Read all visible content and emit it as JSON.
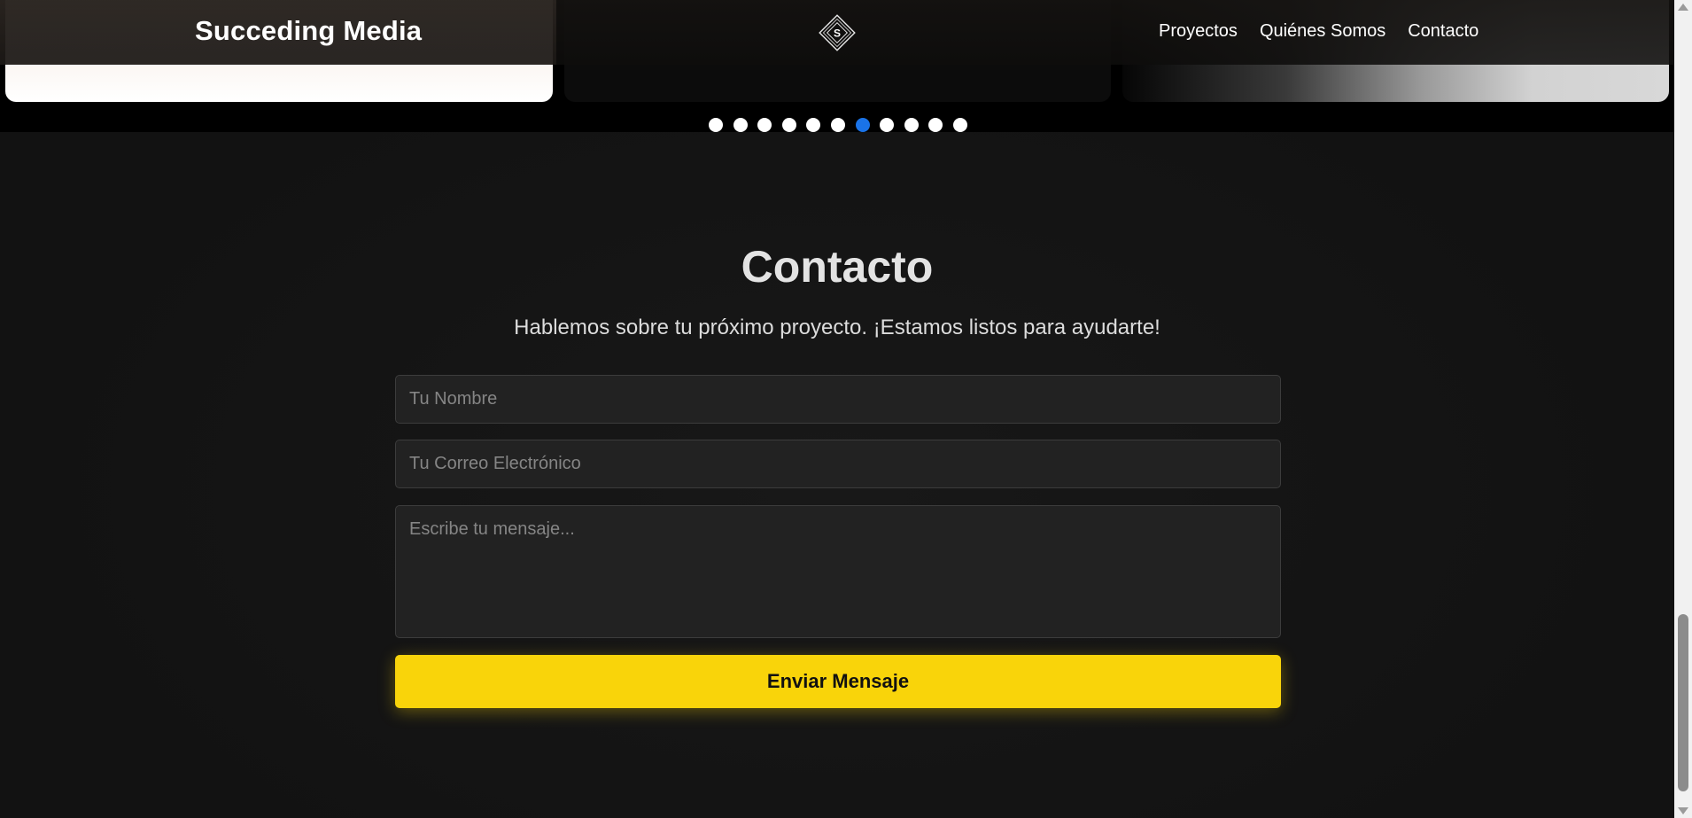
{
  "header": {
    "brand": "Succeding Media",
    "logo_letter": "S",
    "nav": [
      "Proyectos",
      "Quiénes Somos",
      "Contacto"
    ]
  },
  "carousel": {
    "dot_count": 11,
    "active_index": 6,
    "active_color": "#1a73e8"
  },
  "contact": {
    "title": "Contacto",
    "subtitle": "Hablemos sobre tu próximo proyecto. ¡Estamos listos para ayudarte!",
    "name_placeholder": "Tu Nombre",
    "email_placeholder": "Tu Correo Electrónico",
    "message_placeholder": "Escribe tu mensaje...",
    "submit_label": "Enviar Mensaje",
    "accent_color": "#f9d40a"
  }
}
